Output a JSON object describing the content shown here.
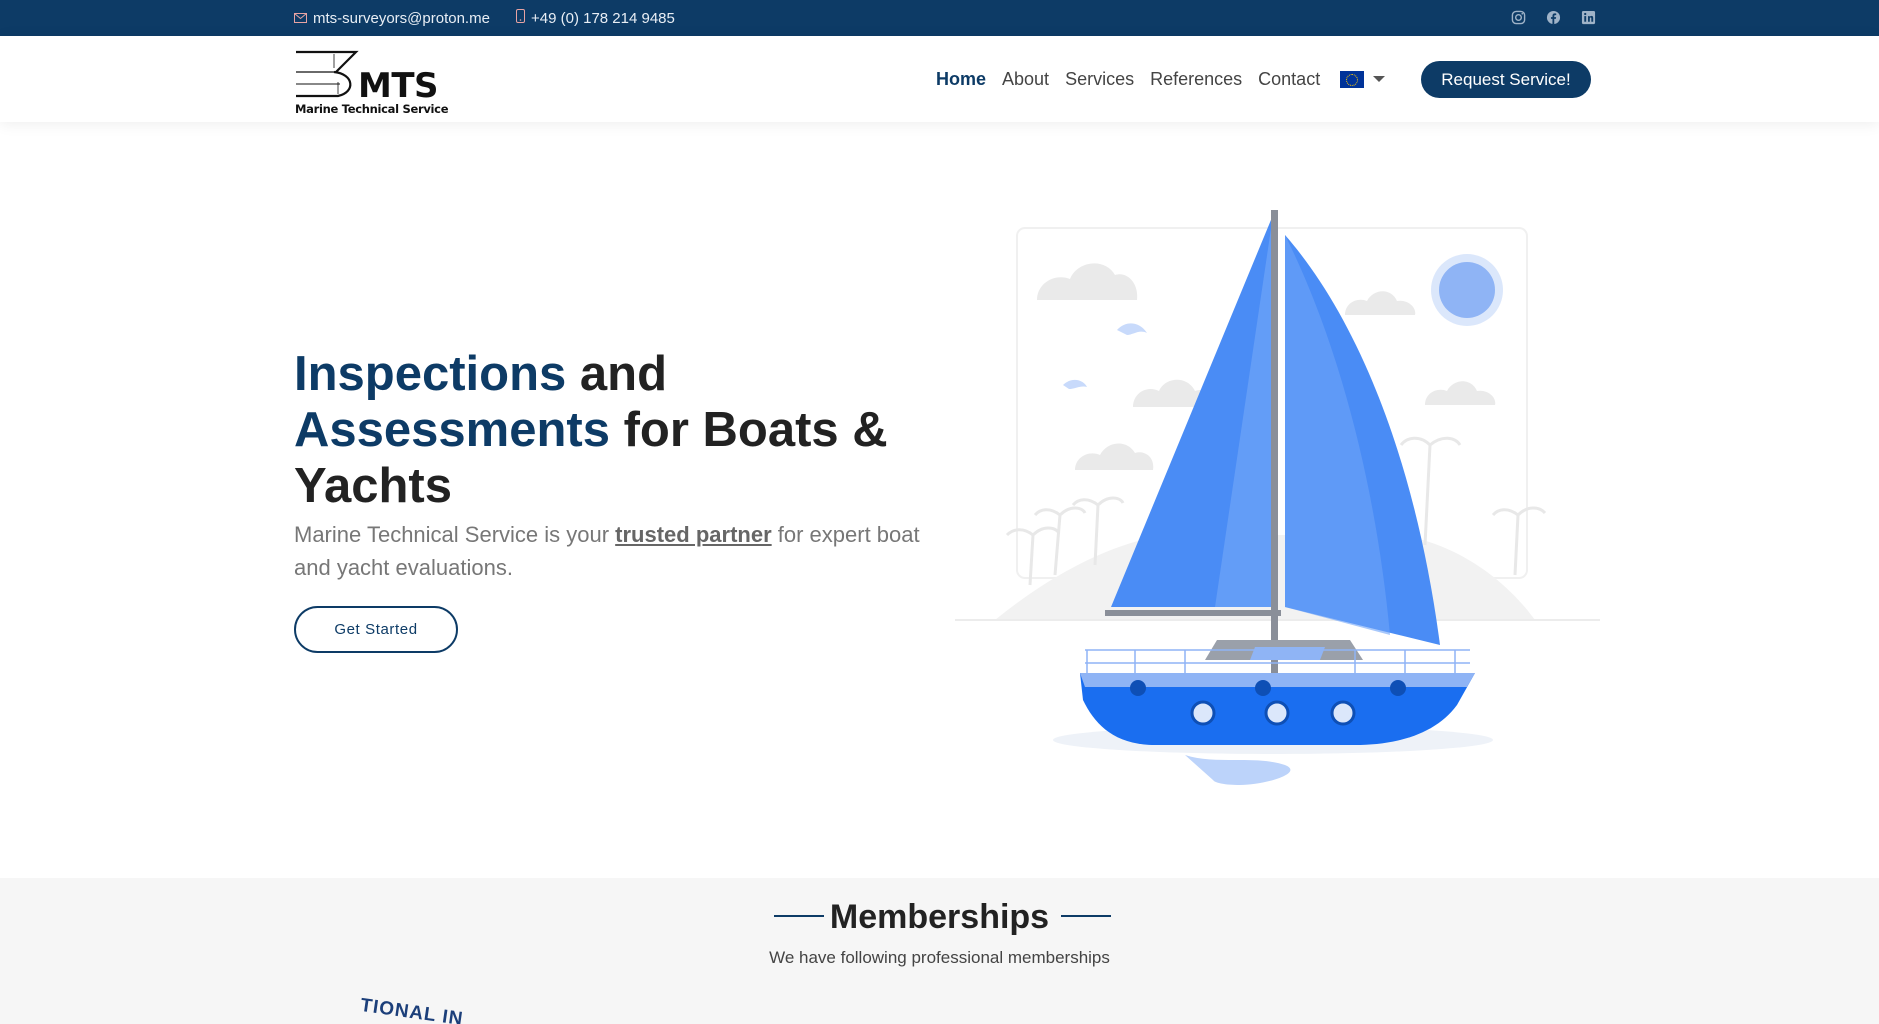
{
  "topbar": {
    "email": "mts-surveyors@proton.me",
    "phone": "+49 (0) 178 214 9485",
    "social_icons": [
      "instagram-icon",
      "facebook-icon",
      "linkedin-icon"
    ]
  },
  "header": {
    "logo_text": "MTS",
    "logo_tagline": "Marine Technical Service",
    "nav": [
      "Home",
      "About",
      "Services",
      "References",
      "Contact"
    ],
    "active_nav": "Home",
    "language_icon": "eu-flag-icon",
    "cta_label": "Request Service!"
  },
  "hero": {
    "title_part1": "Inspections",
    "title_part2": " and",
    "title_part3": "Assessments",
    "title_part4": " for Boats &",
    "title_part5": "Yachts",
    "subtitle_before": "Marine Technical Service is your ",
    "subtitle_emphasis": "trusted partner",
    "subtitle_after": " for expert boat and yacht evaluations.",
    "button_label": "Get Started"
  },
  "memberships": {
    "title": "Memberships",
    "subtitle": "We have following professional memberships",
    "partial_logo_text": "TIONAL IN"
  },
  "colors": {
    "primary": "#0d3b66",
    "sail_blue": "#4a8cf5",
    "hull_blue": "#1a6ef0"
  }
}
